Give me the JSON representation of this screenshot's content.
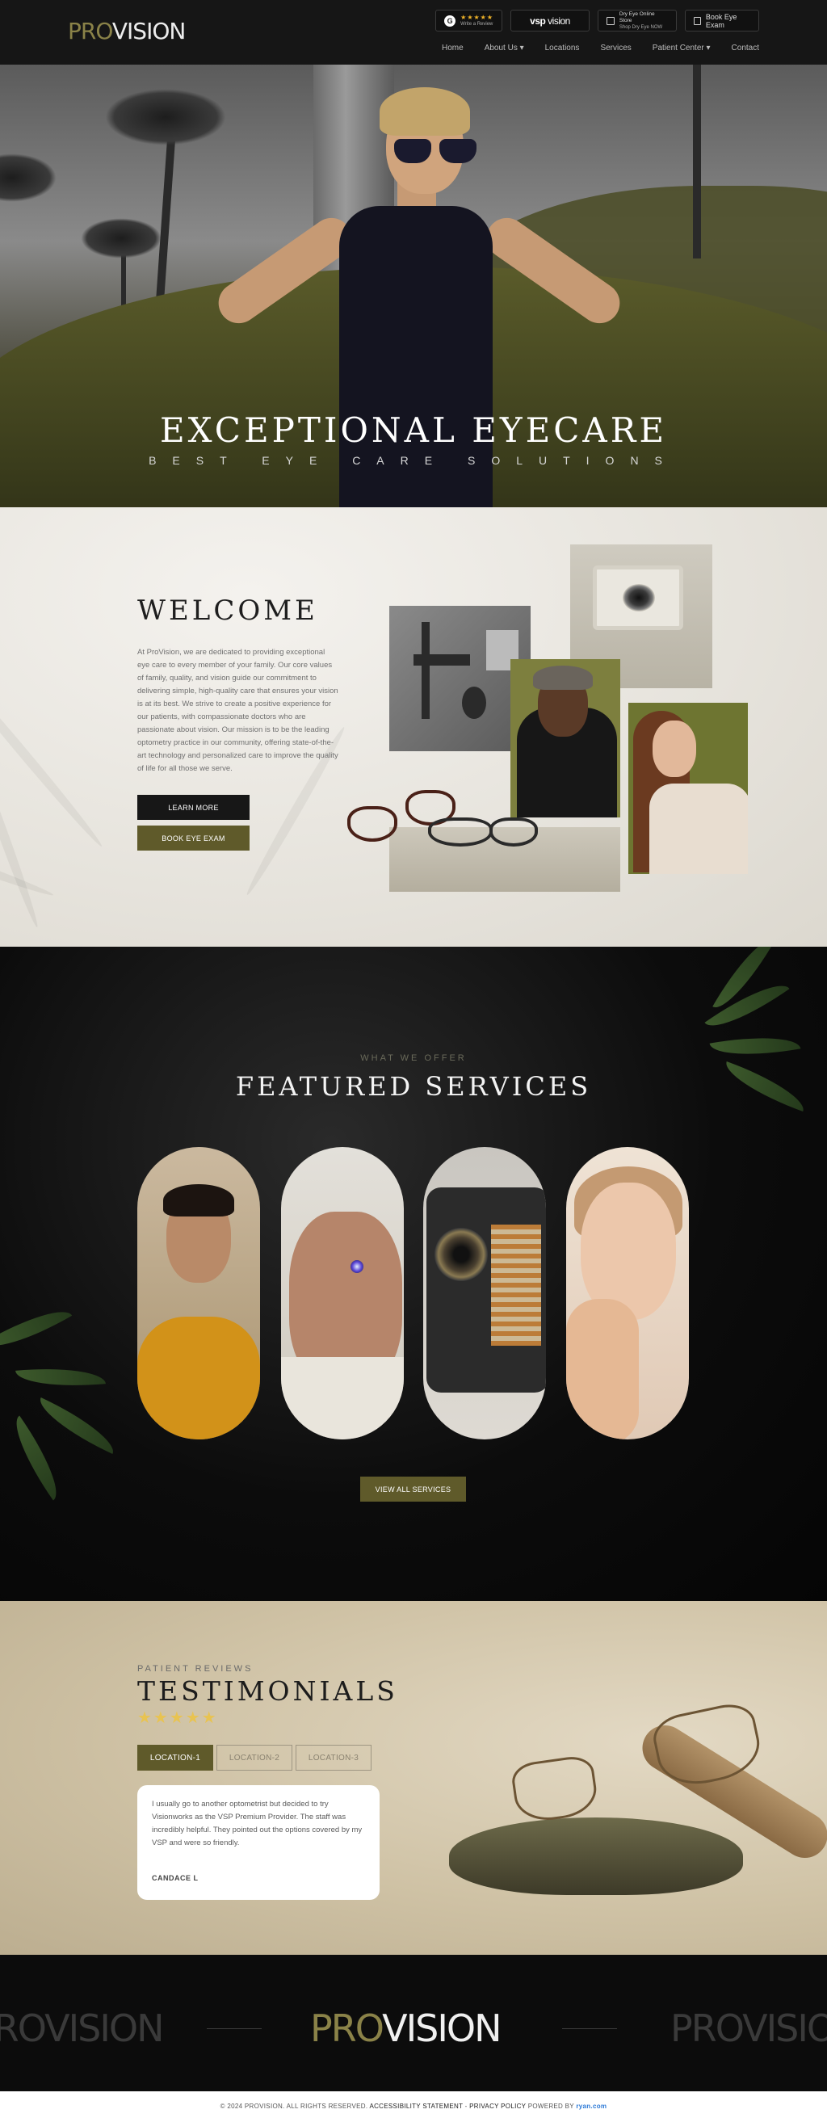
{
  "header": {
    "logo_pro": "PRO",
    "logo_vision": "VISION",
    "review_badge": {
      "icon": "google-g-icon",
      "letter": "G",
      "stars": "★★★★★",
      "label": "Write a Review"
    },
    "vsp_badge": {
      "bold": "vsp",
      "light": " vision"
    },
    "store_badge": {
      "line1": "Dry Eye Online Store",
      "line2": "Shop Dry Eye NOW"
    },
    "book_button": "Book Eye Exam",
    "nav": [
      "Home",
      "About Us ▾",
      "Locations",
      "Services",
      "Patient Center ▾",
      "Contact"
    ]
  },
  "hero": {
    "title": "EXCEPTIONAL EYECARE",
    "subtitle": "BEST EYE CARE SOLUTIONS"
  },
  "welcome": {
    "title": "WELCOME",
    "body": "At ProVision, we are dedicated to providing exceptional eye care to every member of your family. Our core values of family, quality, and vision guide our commitment to delivering simple, high-quality care that ensures your vision is at its best. We strive to create a positive experience for our patients, with compassionate doctors who are passionate about vision. Our mission is to be the leading optometry practice in our community, offering state-of-the-art technology and personalized care to improve the quality of life for all those we serve.",
    "learn_more": "LEARN MORE",
    "book_exam": "BOOK EYE EXAM"
  },
  "services": {
    "eyebrow": "WHAT WE OFFER",
    "title": "FEATURED SERVICES",
    "view_all": "VIEW ALL SERVICES"
  },
  "testimonials": {
    "eyebrow": "PATIENT REVIEWS",
    "title": "TESTIMONIALS",
    "stars": "★★★★★",
    "tabs": [
      "LOCATION-1",
      "LOCATION-2",
      "LOCATION-3"
    ],
    "active_tab": 0,
    "quote": "I usually go to another optometrist but decided to try Visionworks as the VSP Premium Provider. The staff was incredibly helpful. They pointed out the options covered by my VSP and were so friendly.",
    "author": "CANDACE L"
  },
  "footer": {
    "logo_pro": "PRO",
    "logo_vision": "VISION",
    "copyright": "© 2024 PROVISION. ALL RIGHTS RESERVED.",
    "accessibility": "ACCESSIBILITY STATEMENT",
    "privacy": "PRIVACY POLICY",
    "powered_by": "POWERED BY",
    "powered_brand": "ryan.com",
    "separator": " - "
  },
  "colors": {
    "olive": "#5f5a2a",
    "logo_gold": "#8a8248",
    "dark": "#161616",
    "star": "#e8c351"
  }
}
